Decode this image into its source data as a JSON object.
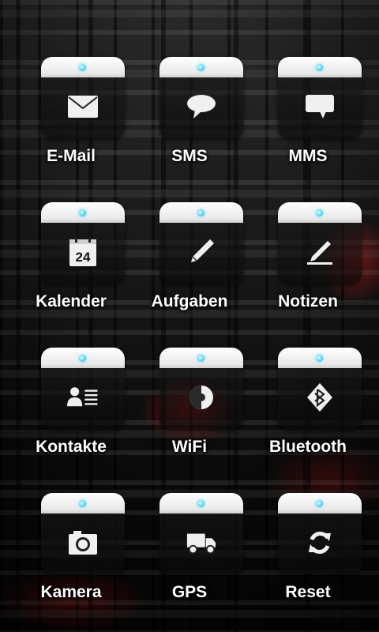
{
  "launcher": {
    "tiles": [
      {
        "label": "E-Mail",
        "icon": "envelope-icon"
      },
      {
        "label": "SMS",
        "icon": "speech-bubble-icon"
      },
      {
        "label": "MMS",
        "icon": "message-bubble-icon"
      },
      {
        "label": "Kalender",
        "icon": "calendar-icon",
        "icon_text": "24"
      },
      {
        "label": "Aufgaben",
        "icon": "pencil-icon"
      },
      {
        "label": "Notizen",
        "icon": "note-pen-icon"
      },
      {
        "label": "Kontakte",
        "icon": "contact-card-icon"
      },
      {
        "label": "WiFi",
        "icon": "wifi-toggle-icon"
      },
      {
        "label": "Bluetooth",
        "icon": "bluetooth-icon"
      },
      {
        "label": "Kamera",
        "icon": "camera-icon"
      },
      {
        "label": "GPS",
        "icon": "truck-icon"
      },
      {
        "label": "Reset",
        "icon": "refresh-icon"
      }
    ]
  },
  "colors": {
    "led": "#6ee0f7",
    "cap": "#f2f2f2",
    "label": "#ffffff",
    "accent_glow": "#d81414"
  }
}
